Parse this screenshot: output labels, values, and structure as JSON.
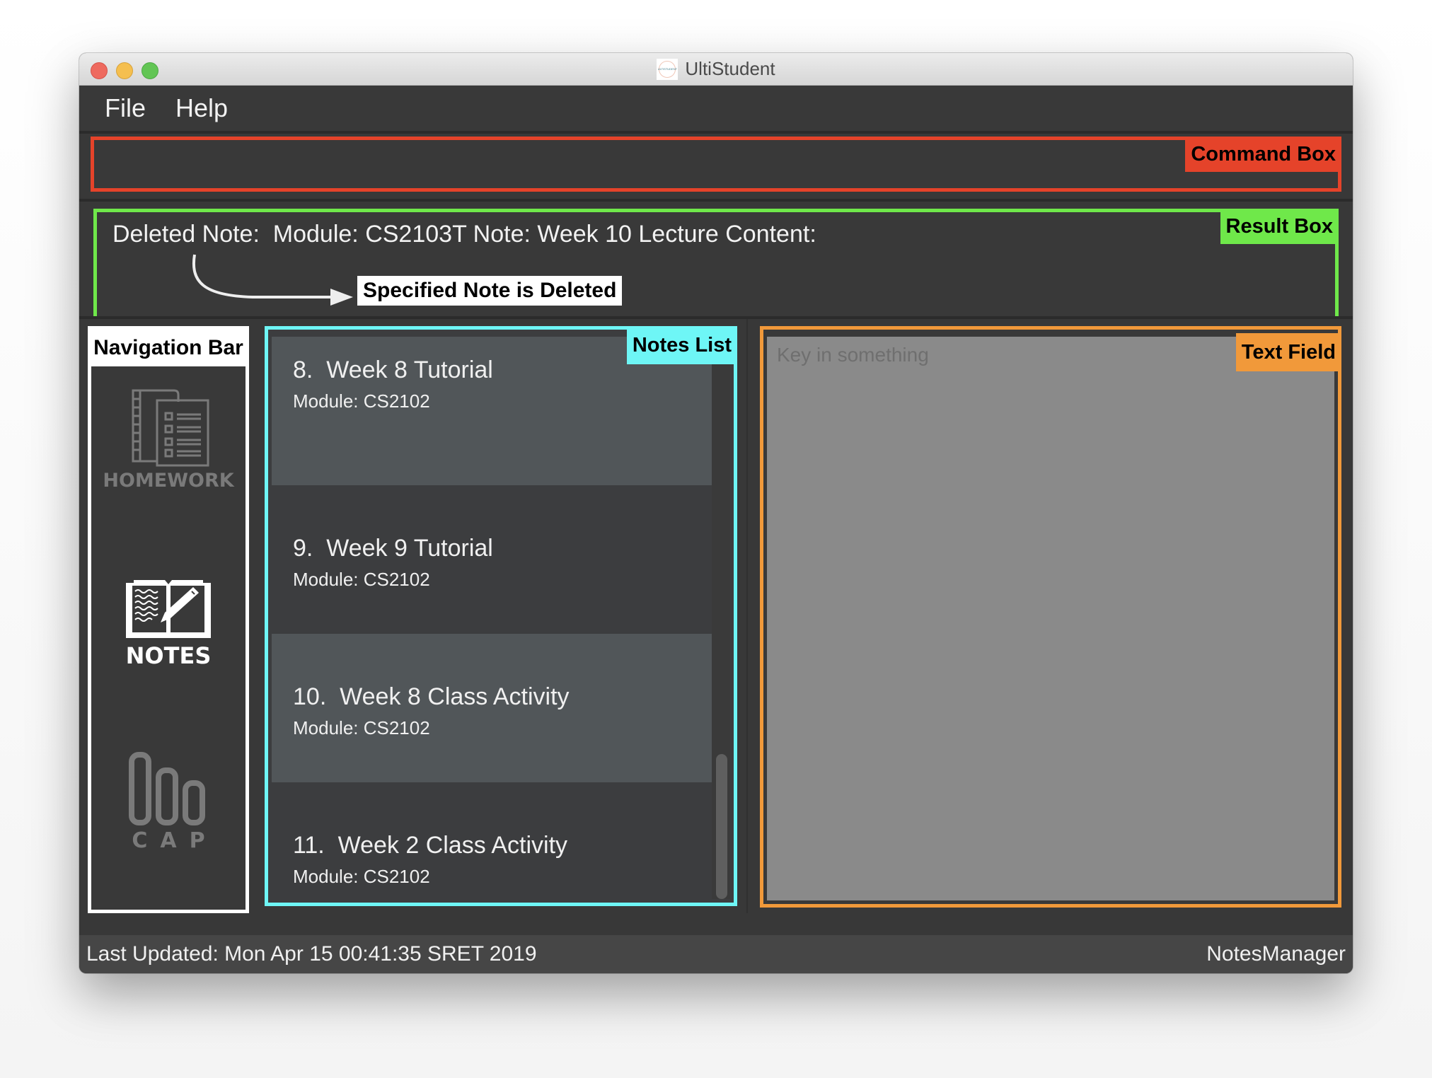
{
  "window": {
    "title": "UltiStudent",
    "logo_text": "ULTISTUDENT"
  },
  "menu": {
    "items": [
      {
        "label": "File"
      },
      {
        "label": "Help"
      }
    ]
  },
  "command_box": {
    "value": "",
    "annotation": "Command Box"
  },
  "result_box": {
    "text": "Deleted Note:  Module: CS2103T Note: Week 10 Lecture Content:",
    "annotation": "Result Box",
    "callout": "Specified Note is Deleted"
  },
  "navigation": {
    "annotation": "Navigation Bar",
    "items": [
      {
        "label": "HOMEWORK",
        "icon": "homework-icon",
        "active": false
      },
      {
        "label": "NOTES",
        "icon": "notes-icon",
        "active": true
      },
      {
        "label": "CAP",
        "icon": "cap-icon",
        "active": false
      }
    ]
  },
  "notes_list": {
    "annotation": "Notes List",
    "items": [
      {
        "index": "8.",
        "title": "Week 8 Tutorial",
        "module": "Module: CS2102"
      },
      {
        "index": "9.",
        "title": "Week 9 Tutorial",
        "module": "Module: CS2102"
      },
      {
        "index": "10.",
        "title": "Week 8 Class Activity",
        "module": "Module: CS2102"
      },
      {
        "index": "11.",
        "title": "Week 2 Class Activity",
        "module": "Module: CS2102"
      }
    ]
  },
  "text_field": {
    "annotation": "Text Field",
    "placeholder": "Key in something",
    "value": ""
  },
  "status_bar": {
    "last_updated": "Last Updated: Mon Apr 15 00:41:35 SRET 2019",
    "manager": "NotesManager"
  },
  "colors": {
    "command_accent": "#e5432a",
    "result_accent": "#6fe84a",
    "notes_accent": "#6ef6f6",
    "text_accent": "#f1993a"
  }
}
